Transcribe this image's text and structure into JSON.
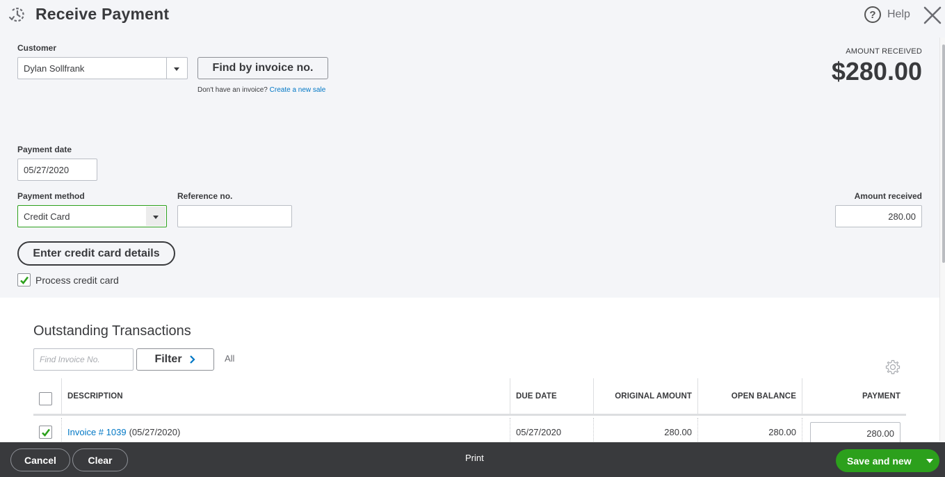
{
  "header": {
    "title": "Receive Payment",
    "help_label": "Help",
    "icons": {
      "title": "history-clock-icon",
      "help": "help-circle-icon",
      "close": "close-x-icon"
    }
  },
  "customer": {
    "label": "Customer",
    "value": "Dylan Sollfrank",
    "find_button": "Find by invoice no.",
    "no_invoice_text": "Don't have an invoice?",
    "create_sale_link": "Create a new sale"
  },
  "amount_summary": {
    "label": "AMOUNT RECEIVED",
    "value": "$280.00"
  },
  "payment_date": {
    "label": "Payment date",
    "value": "05/27/2020"
  },
  "payment_method": {
    "label": "Payment method",
    "value": "Credit Card"
  },
  "reference": {
    "label": "Reference no.",
    "value": ""
  },
  "amount_received": {
    "label": "Amount received",
    "value": "280.00"
  },
  "credit_card": {
    "enter_details_button": "Enter credit card details",
    "process_label": "Process credit card",
    "process_checked": true
  },
  "outstanding": {
    "title": "Outstanding Transactions",
    "find_placeholder": "Find Invoice No.",
    "filter_button": "Filter",
    "filter_value": "All",
    "columns": [
      "DESCRIPTION",
      "DUE DATE",
      "ORIGINAL AMOUNT",
      "OPEN BALANCE",
      "PAYMENT"
    ],
    "rows": [
      {
        "checked": true,
        "invoice_link": "Invoice # 1039",
        "invoice_date": "(05/27/2020)",
        "due_date": "05/27/2020",
        "original_amount": "280.00",
        "open_balance": "280.00",
        "payment": "280.00"
      }
    ]
  },
  "footer": {
    "cancel": "Cancel",
    "clear": "Clear",
    "print": "Print",
    "save": "Save and new"
  },
  "colors": {
    "accent_green": "#2ca01c",
    "link_blue": "#0077c5",
    "footer_bg": "#393a3d",
    "form_bg": "#f4f5f8"
  }
}
